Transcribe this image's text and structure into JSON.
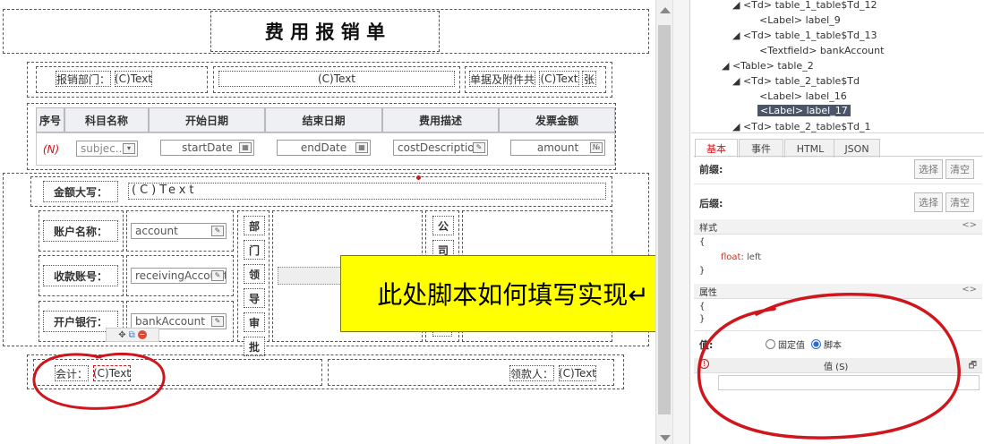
{
  "form": {
    "title": "费 用 报 销 单",
    "dept_label": "报销部门：",
    "dept_value": "(C)Text",
    "center_value": "(C)Text",
    "attach_label": "单据及附件共",
    "attach_value": "(C)Text",
    "attach_unit": "张",
    "table": {
      "headers": [
        "序号",
        "科目名称",
        "开始日期",
        "结束日期",
        "费用描述",
        "发票金额"
      ],
      "row_index": "(N)",
      "subject_value": "subjec...",
      "start_date": "startDate",
      "end_date": "endDate",
      "cost_description": "costDescription",
      "amount": "amount"
    },
    "amount_upper_label": "金额大写：",
    "amount_upper_value": "(C)Text",
    "account_name_label": "账户名称：",
    "account_value": "account",
    "receiving_account_label": "收款账号：",
    "receiving_account_value": "receivingAccount",
    "bank_label": "开户银行：",
    "bank_value": "bankAccount",
    "dept_leader_chars": [
      "部",
      "门",
      "领",
      "导",
      "审",
      "批"
    ],
    "company_chars": [
      "公",
      "司"
    ],
    "accountant_label": "会计：",
    "accountant_value": "(C)Text",
    "payee_label": "领款人：",
    "payee_value": "(C)Text"
  },
  "callout": {
    "text": "此处脚本如何填写实现↵"
  },
  "tree": {
    "rows": [
      "◢ <Td> table_1_table$Td_12",
      "<Label> label_9",
      "◢ <Td> table_1_table$Td_13",
      "<Textfield> bankAccount",
      "◢ <Table> table_2",
      "◢ <Td> table_2_table$Td",
      "<Label> label_16",
      "<Label> label_17",
      "◢ <Td> table_2_table$Td_1"
    ]
  },
  "props": {
    "tabs": [
      "基本",
      "事件",
      "HTML",
      "JSON"
    ],
    "prefix_label": "前缀:",
    "suffix_label": "后缀:",
    "select_btn": "选择",
    "clear_btn": "清空",
    "style_section": "样式",
    "style_open": "{",
    "style_prop": "float",
    "style_value": ": left",
    "style_close": "}",
    "attr_section": "属性",
    "attr_open": "{",
    "attr_close": "}",
    "value_label": "值:",
    "radio_fixed": "固定值",
    "radio_script": "脚本",
    "value_section": "值 (S)",
    "expand_glyph": "<>",
    "restore_glyph": "🗗"
  },
  "colors": {
    "accent_red": "#d0161d",
    "callout_fill": "#ffff00",
    "selected_tree": "#4a5568",
    "link_red": "#cc0000"
  }
}
